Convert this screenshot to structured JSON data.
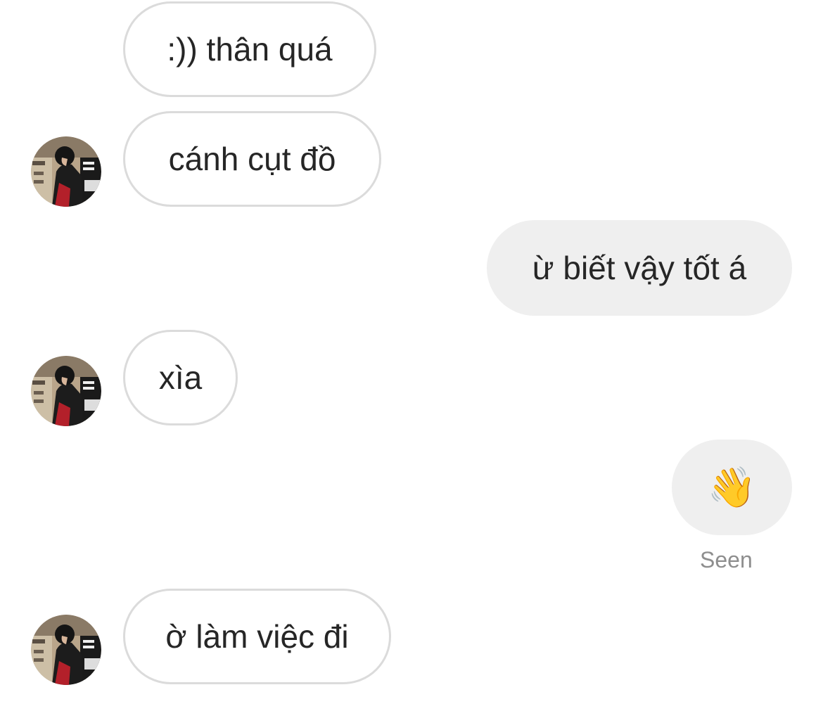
{
  "thread": {
    "messages": [
      {
        "text": ":)) thân quá",
        "direction": "received"
      },
      {
        "text": "cánh cụt đồ",
        "direction": "received"
      },
      {
        "text": "ừ biết vậy tốt á",
        "direction": "sent"
      },
      {
        "text": "xìa",
        "direction": "received"
      },
      {
        "text": "👋",
        "direction": "sent"
      },
      {
        "text": "ờ làm việc đi",
        "direction": "received"
      }
    ],
    "seen_label": "Seen"
  },
  "colors": {
    "received_border": "#dbdbdb",
    "sent_bg": "#efefef",
    "text": "#262626",
    "seen_text": "#8e8e8e"
  }
}
